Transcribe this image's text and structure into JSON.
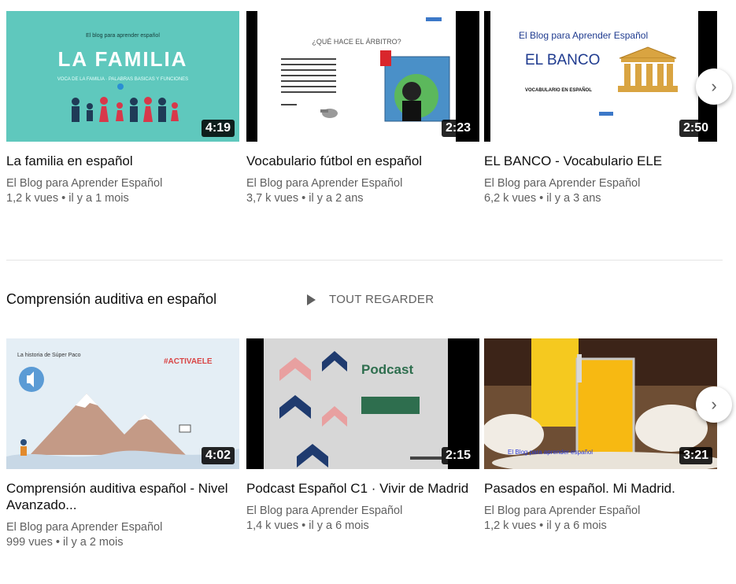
{
  "row1": {
    "videos": [
      {
        "title": "La familia en español",
        "channel": "El Blog para Aprender Español",
        "meta": "1,2 k vues • il y a 1 mois",
        "duration": "4:19",
        "thumb": {
          "small_title": "El blog para aprender español",
          "headline": "LA FAMILIA",
          "subtitle": "VOCA DE LA FAMILIA · PALABRAS BASICAS Y FUNCIONES",
          "bg": "#5fc8bd"
        }
      },
      {
        "title": "Vocabulario fútbol en español",
        "channel": "El Blog para Aprender Español",
        "meta": "3,7 k vues • il y a 2 ans",
        "duration": "2:23",
        "thumb": {
          "headline": "¿QUÉ HACE EL ÁRBITRO?",
          "bg": "#ffffff"
        }
      },
      {
        "title": "EL BANCO - Vocabulario ELE",
        "channel": "El Blog para Aprender Español",
        "meta": "6,2 k vues • il y a 3 ans",
        "duration": "2:50",
        "thumb": {
          "small_title": "El Blog para Aprender Español",
          "headline": "EL BANCO",
          "subtitle": "VOCABULARIO EN ESPAÑOL",
          "bg": "#ffffff"
        }
      }
    ]
  },
  "shelf": {
    "title": "Comprensión auditiva en español",
    "play_all": "TOUT REGARDER"
  },
  "row2": {
    "videos": [
      {
        "title": "Comprensión auditiva español - Nivel Avanzado...",
        "channel": "El Blog para Aprender Español",
        "meta": "999 vues • il y a 2 mois",
        "duration": "4:02",
        "thumb": {
          "small_title": "La historia de Súper Paco",
          "headline": "#ACTIVAELE",
          "bg": "#e4eef5"
        }
      },
      {
        "title": "Podcast Español C1 · Vivir de Madrid",
        "channel": "El Blog para Aprender Español",
        "meta": "1,4 k vues • il y a 6 mois",
        "duration": "2:15",
        "thumb": {
          "headline": "Podcast",
          "bg": "#d7d7d7"
        }
      },
      {
        "title": "Pasados en español. Mi Madrid.",
        "channel": "El Blog para Aprender Español",
        "meta": "1,2 k vues • il y a 6 mois",
        "duration": "3:21",
        "thumb": {
          "caption": "El Blog para aprender español",
          "bg": "#7a5a3a"
        }
      }
    ]
  },
  "icons": {
    "next": "chevron-right-icon",
    "play": "play-icon",
    "speaker": "speaker-icon"
  }
}
